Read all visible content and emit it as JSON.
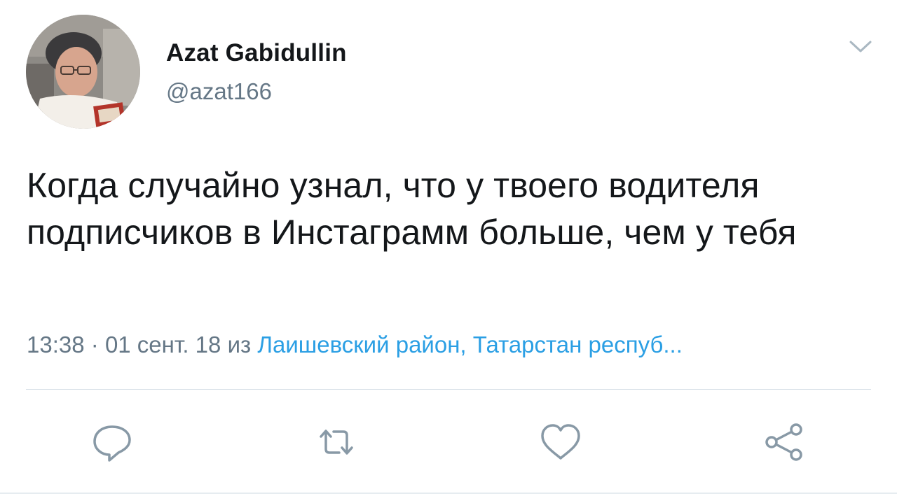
{
  "tweet": {
    "author": {
      "name": "Azat Gabidullin",
      "handle": "@azat166"
    },
    "text": "Когда случайно узнал, что у твоего водителя подписчиков в Инстаграмм больше, чем у тебя",
    "meta": {
      "time": "13:38",
      "separator": "·",
      "date": "01 сент. 18",
      "from_word": "из",
      "location": "Лаишевский район, Татарстан респуб..."
    },
    "actions": [
      {
        "icon": "reply-icon"
      },
      {
        "icon": "retweet-icon"
      },
      {
        "icon": "like-icon"
      },
      {
        "icon": "share-icon"
      }
    ]
  },
  "colors": {
    "text": "#14171a",
    "secondary": "#657786",
    "link": "#2b9fe4",
    "icon": "#8899a6",
    "divider": "#d3dde5"
  }
}
